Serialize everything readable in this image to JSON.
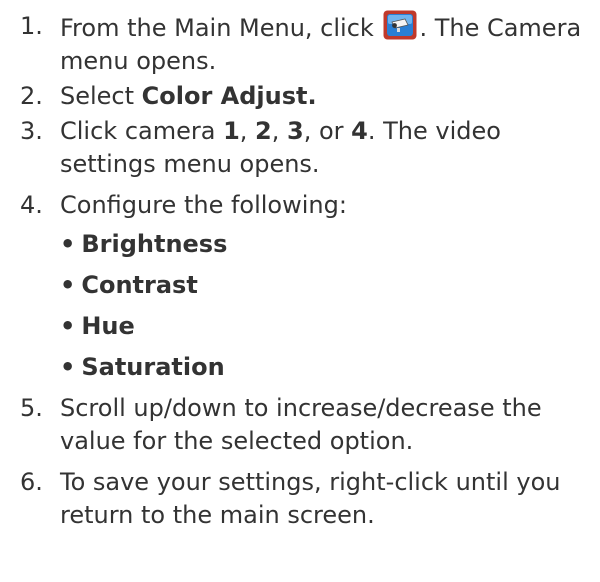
{
  "steps": [
    {
      "number": "1.",
      "text_before_icon": "From the Main Menu, click ",
      "icon": "camera-menu-icon",
      "text_after_icon": ". The Camera menu opens."
    },
    {
      "number": "2.",
      "prefix": "Select ",
      "bold": "Color Adjust."
    },
    {
      "number": "3.",
      "prefix": "Click camera ",
      "cam1": "1",
      "sep1": ", ",
      "cam2": "2",
      "sep2": ", ",
      "cam3": "3",
      "sep3": ", or ",
      "cam4": "4",
      "suffix": ". The video settings menu opens."
    },
    {
      "number": "4.",
      "text": "Configure the following:",
      "options": [
        "Brightness",
        "Contrast",
        "Hue",
        "Saturation"
      ]
    },
    {
      "number": "5.",
      "text": "Scroll up/down to increase/decrease the value for the selected option."
    },
    {
      "number": "6.",
      "text": "To save your settings, right-click until you return to the main screen."
    }
  ],
  "bullet_char": "•",
  "colors": {
    "text": "#333333",
    "icon_frame": "#c0392b",
    "icon_fill": "#2a7fd4"
  }
}
